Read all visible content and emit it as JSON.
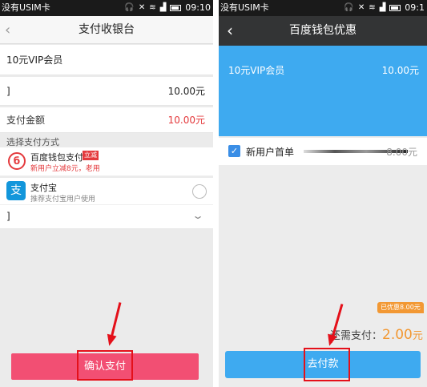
{
  "left": {
    "status": {
      "carrier": "没有USIM卡",
      "time": "09:10"
    },
    "title": "支付收银台",
    "product_name": "10元VIP会员",
    "price_row": {
      "label": "]",
      "value": "10.00元"
    },
    "amount_row": {
      "label": "支付金额",
      "value": "10.00元"
    },
    "section_title": "选择支付方式",
    "baidu": {
      "name": "百度钱包支付",
      "tag": "立减",
      "sub": "新用户立减8元，老用"
    },
    "alipay": {
      "name": "支付宝",
      "sub": "推荐支付宝用户使用"
    },
    "more_label": "]",
    "confirm_button": "确认支付",
    "colors": {
      "confirm": "#f24f73",
      "price_red": "#e4393c"
    }
  },
  "right": {
    "status": {
      "carrier": "没有USIM卡",
      "time": "09:1"
    },
    "title": "百度钱包优惠",
    "product_name": "10元VIP会员",
    "product_value": "10.00元",
    "coupon_label": "新用户首单",
    "coupon_value": "8.00元",
    "discount_badge": "已优惠8.00元",
    "still_pay_label": "还需支付：",
    "still_pay_amount": "2.00",
    "still_pay_unit": "元",
    "pay_button": "去付款",
    "colors": {
      "accent": "#3eaaf0",
      "orange": "#f29833"
    }
  }
}
